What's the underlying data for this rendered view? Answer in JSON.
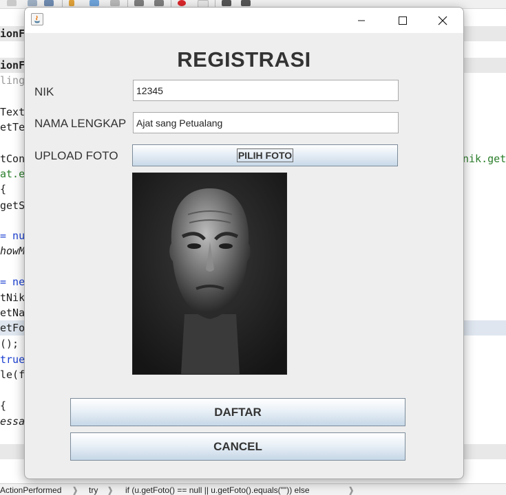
{
  "dialog": {
    "heading": "REGISTRASI",
    "fields": {
      "nik": {
        "label": "NIK",
        "value": "12345"
      },
      "nama": {
        "label": "NAMA LENGKAP",
        "value": "Ajat sang Petualang"
      },
      "foto": {
        "label": "UPLOAD FOTO",
        "button": "PILIH FOTO"
      }
    },
    "buttons": {
      "submit": "DAFTAR",
      "cancel": "CANCEL"
    }
  },
  "ide": {
    "left_fragments": [
      "ionF",
      "ionF",
      "ling",
      "Text",
      "etTe",
      "tCon",
      "at.e",
      "  {",
      "getS",
      "= nu",
      "howM",
      "= ne",
      "tNik",
      "etNa",
      "etFo",
      "();",
      "true",
      "le(f",
      "  {",
      "essa"
    ],
    "right_fragment": "nik.get"
  },
  "statusbar": {
    "crumbs": [
      "ActionPerformed",
      "try",
      "if (u.getFoto() == null || u.getFoto().equals(\"\")) else"
    ]
  }
}
